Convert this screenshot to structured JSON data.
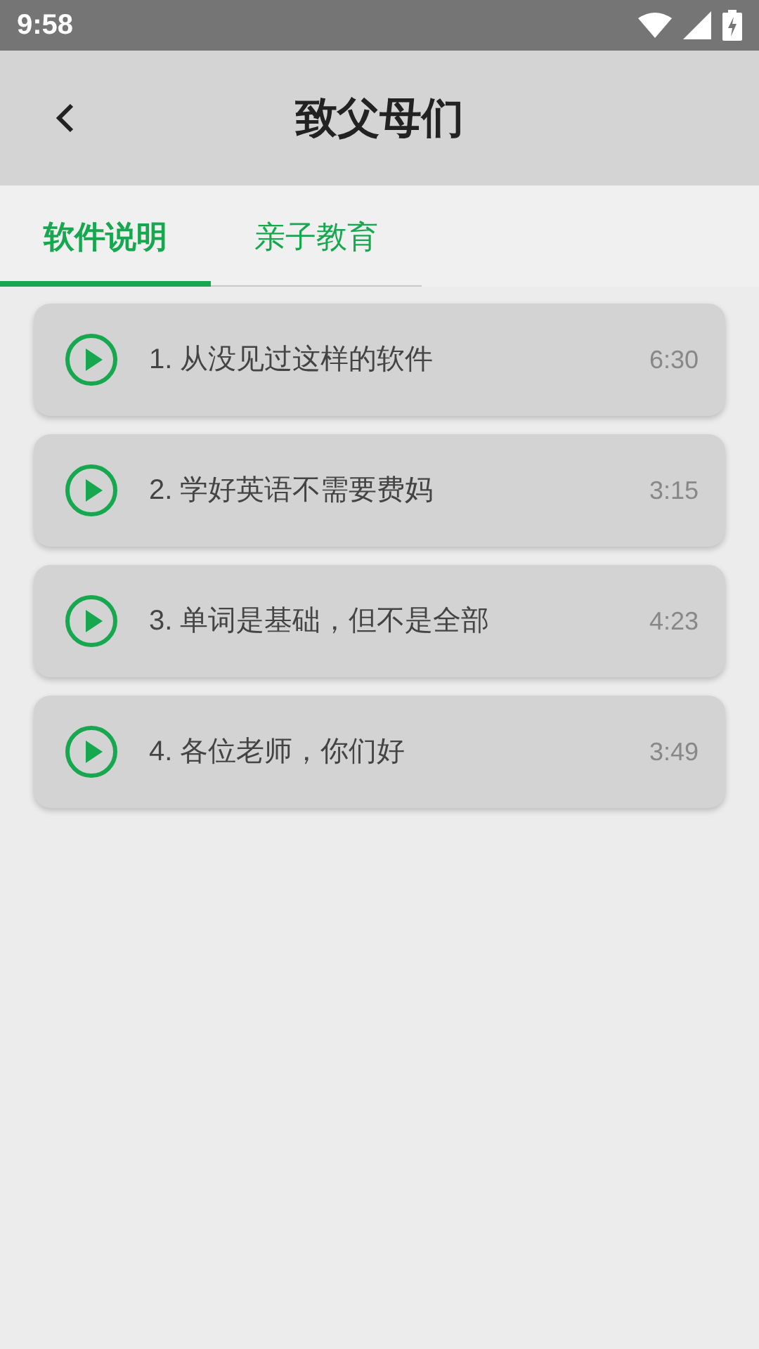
{
  "status_bar": {
    "time": "9:58"
  },
  "app_bar": {
    "title": "致父母们"
  },
  "tabs": [
    {
      "label": "软件说明",
      "selected": true
    },
    {
      "label": "亲子教育",
      "selected": false
    }
  ],
  "items": [
    {
      "title": "1. 从没见过这样的软件",
      "duration": "6:30"
    },
    {
      "title": "2. 学好英语不需要费妈",
      "duration": "3:15"
    },
    {
      "title": "3. 单词是基础，但不是全部",
      "duration": "4:23"
    },
    {
      "title": "4. 各位老师，你们好",
      "duration": "3:49"
    }
  ]
}
